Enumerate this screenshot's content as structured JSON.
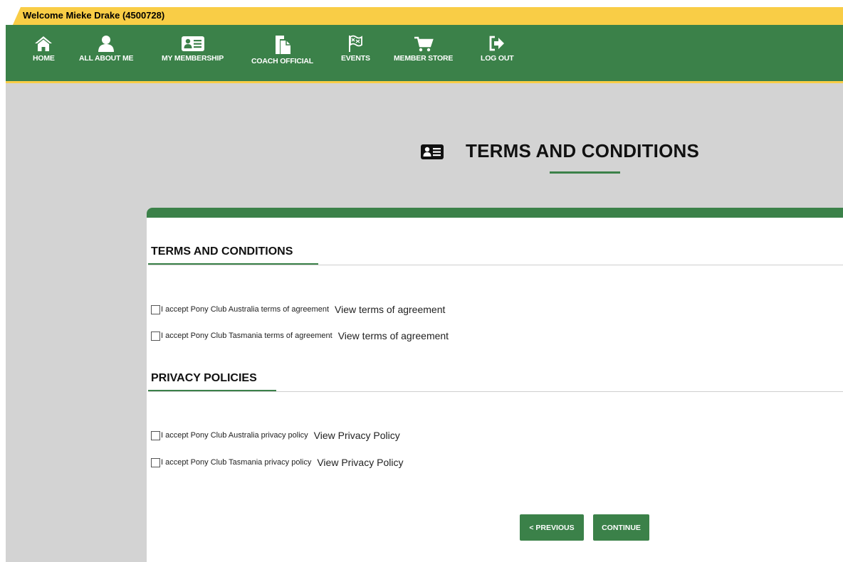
{
  "header": {
    "welcome": "Welcome Mieke Drake (4500728)"
  },
  "nav": {
    "items": [
      {
        "label": "HOME",
        "icon": "home-icon"
      },
      {
        "label": "ALL ABOUT ME",
        "icon": "user-icon"
      },
      {
        "label": "MY MEMBERSHIP",
        "icon": "id-card-icon"
      },
      {
        "label": "COACH OFFICIAL",
        "icon": "document-icon"
      },
      {
        "label": "EVENTS",
        "icon": "flag-icon"
      },
      {
        "label": "MEMBER STORE",
        "icon": "cart-icon"
      },
      {
        "label": "LOG OUT",
        "icon": "logout-icon"
      }
    ]
  },
  "page": {
    "title": "TERMS AND CONDITIONS",
    "title_icon": "id-card-icon"
  },
  "terms": {
    "heading": "TERMS AND CONDITIONS",
    "items": [
      {
        "label": "I accept Pony Club Australia terms of agreement",
        "link": "View terms of agreement",
        "checked": false
      },
      {
        "label": "I accept Pony Club Tasmania terms of agreement",
        "link": "View terms of agreement",
        "checked": false
      }
    ]
  },
  "privacy": {
    "heading": "PRIVACY POLICIES",
    "items": [
      {
        "label": "I accept Pony Club Australia privacy policy",
        "link": "View Privacy Policy",
        "checked": false
      },
      {
        "label": "I accept Pony Club Tasmania privacy policy",
        "link": "View Privacy Policy",
        "checked": false
      }
    ]
  },
  "buttons": {
    "previous": "< PREVIOUS",
    "continue": "CONTINUE"
  },
  "colors": {
    "primary_green": "#3b8149",
    "accent_yellow": "#f9cd46",
    "background_gray": "#d3d3d3"
  }
}
